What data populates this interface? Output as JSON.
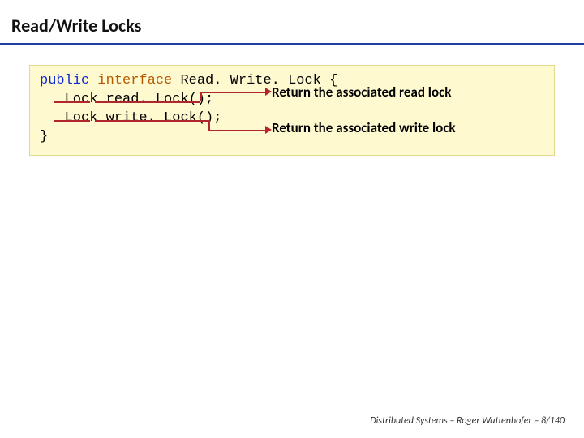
{
  "slide": {
    "title": "Read/Write Locks",
    "code": {
      "line1_kw1": "public",
      "line1_kw2": "interface",
      "line1_rest": " Read. Write. Lock {",
      "line2_indent": "   ",
      "line2_type": "Lock",
      "line2_rest": " read. Lock();",
      "line3_indent": "   ",
      "line3_type": "Lock",
      "line3_rest": " write. Lock();",
      "line4": "}"
    },
    "annotations": {
      "read": "Return the associated read lock",
      "write": "Return the associated write lock"
    },
    "footer": {
      "course": "Distributed Systems",
      "sep": "  –  ",
      "author": "Roger Wattenhofer",
      "page": "  – 8/140"
    }
  }
}
